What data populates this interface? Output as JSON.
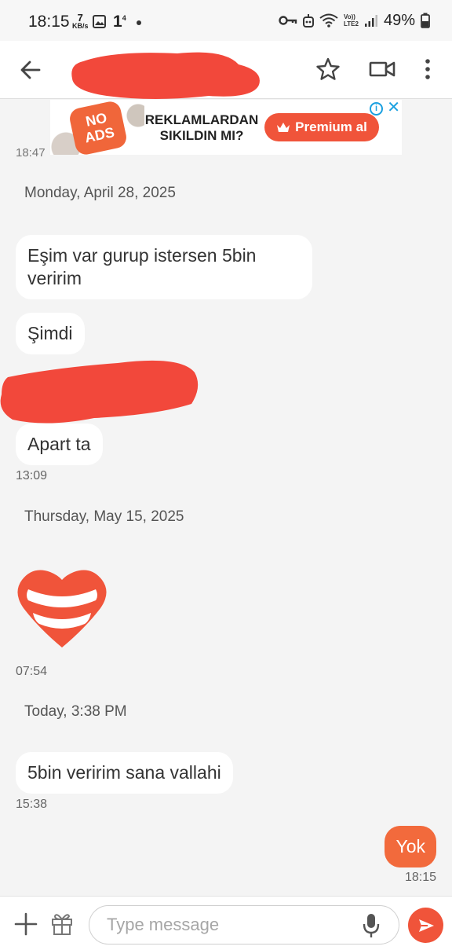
{
  "status_bar": {
    "time": "18:15",
    "net_speed_value": "7",
    "net_speed_unit": "KB/s",
    "notif_count": "1",
    "notif_sup": "4",
    "signal_label_top": "Vo))",
    "signal_label_bottom": "LTE2",
    "battery": "49%"
  },
  "header": {
    "contact_name_redacted": true
  },
  "ad": {
    "badge": "NO ADS",
    "headline_line1": "REKLAMLARDAN",
    "headline_line2": "SIKILDIN MI?",
    "cta": "Premium al",
    "info_glyph": "i",
    "close_glyph": "✕"
  },
  "conversation": {
    "cutoff_time": "18:47",
    "date_sep_1": "Monday, April 28, 2025",
    "msg_1_line1": "Eşim var gurup istersen 5bin",
    "msg_1_line2": "veririm",
    "msg_2": "Şimdi",
    "msg_3": "Apart ta",
    "msg_3_time": "13:09",
    "date_sep_2": "Thursday, May 15, 2025",
    "heart_time": "07:54",
    "date_sep_3": "Today, 3:38 PM",
    "msg_4": "5bin veririm sana vallahi",
    "msg_4_time": "15:38",
    "msg_5_out": "Yok",
    "msg_5_time": "18:15"
  },
  "composer": {
    "placeholder": "Type message"
  },
  "colors": {
    "accent": "#f0543a",
    "outgoing_bubble": "#f26a3c",
    "redaction": "#f2483b",
    "background": "#f4f4f4"
  }
}
